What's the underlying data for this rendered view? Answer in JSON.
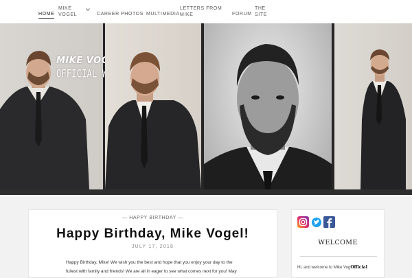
{
  "nav": {
    "items": [
      {
        "label": "HOME"
      },
      {
        "label_line1": "MIKE",
        "label_line2": "VOGEL"
      },
      {
        "label": "CAREER"
      },
      {
        "label": "PHOTOS"
      },
      {
        "label": "MULTIMEDIA"
      },
      {
        "label_line1": "LETTERS FROM",
        "label_line2": "MIKE"
      },
      {
        "label": "FORUM"
      },
      {
        "label_line1": "THE",
        "label_line2": "SITE"
      }
    ]
  },
  "hero": {
    "logo_line1": "MIKE VOGEL",
    "logo_line2": "OFFICIAL WEBSITE"
  },
  "post": {
    "category": "— HAPPY BIRTHDAY —",
    "title": "Happy Birthday, Mike Vogel!",
    "date": "JULY 17, 2018",
    "body": "Happy Birthday, Mike! We wish you the best and hope that you enjoy your day to the fullest with family and friends! We are all in eager to see what comes next for you! May"
  },
  "sidebar": {
    "social_icons": [
      "instagram-icon",
      "twitter-icon",
      "facebook-icon"
    ],
    "welcome": "WELCOME",
    "text_start": "Hi, and welcome to Mike Vog",
    "text_bold": "Official"
  },
  "colors": {
    "nav_bg": "#ffffff",
    "hero_strip": "#262626",
    "page_bg": "#f2f2f2",
    "instagram": "#e1306c",
    "twitter": "#1da1f2",
    "facebook": "#3b5998"
  }
}
